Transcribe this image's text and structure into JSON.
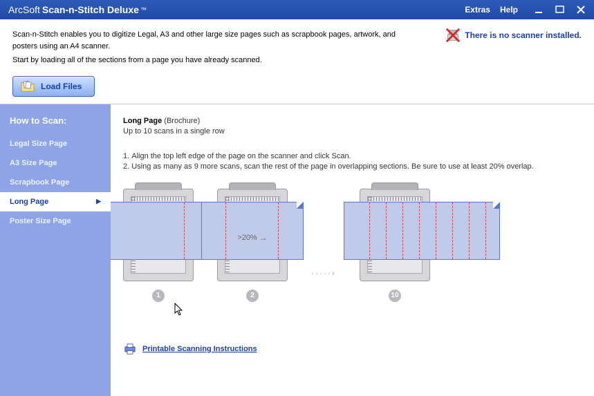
{
  "titlebar": {
    "brand_prefix": "ArcSoft",
    "brand_main": "Scan-n-Stitch Deluxe",
    "tm": "™",
    "menu_extras": "Extras",
    "menu_help": "Help"
  },
  "intro": {
    "line1": "Scan-n-Stitch enables you to digitize Legal, A3 and other large size pages such as scrapbook pages, artwork, and posters using an A4 scanner.",
    "line2": "Start by loading all of the sections from a page you have already scanned."
  },
  "warning_text": "There is no scanner installed.",
  "load_button": "Load Files",
  "sidebar": {
    "heading": "How to Scan:",
    "items": [
      "Legal Size Page",
      "A3 Size Page",
      "Scrapbook Page",
      "Long Page",
      "Poster Size Page"
    ],
    "active_index": 3
  },
  "content": {
    "title": "Long Page",
    "subtitle": "(Brochure)",
    "subline": "Up to 10 scans in a single row",
    "step1": "Align the top left edge of the page on the scanner and click Scan.",
    "step2": "Using as many as 9 more scans, scan the rest of the page in overlapping sections. Be sure to use at least 20% overlap.",
    "overlap_label": ">20%",
    "diagram_numbers": [
      "1",
      "2",
      "10"
    ],
    "dots": "·····›",
    "print_link": "Printable Scanning Instructions"
  }
}
